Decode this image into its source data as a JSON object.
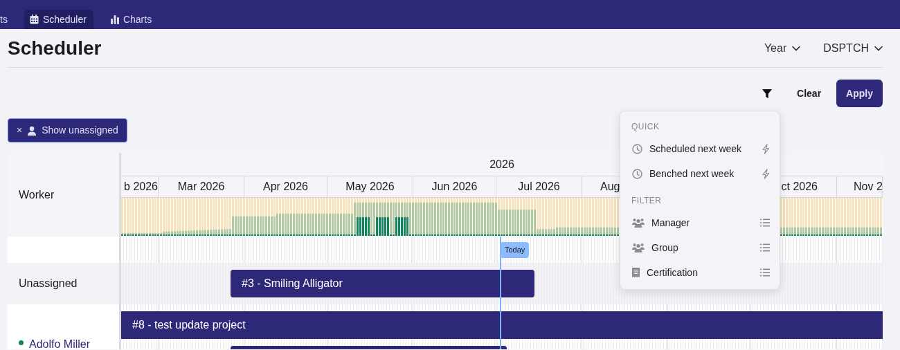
{
  "nav": {
    "tabs": [
      {
        "label": "ts",
        "selected": false
      },
      {
        "label": "Scheduler",
        "selected": true
      },
      {
        "label": "Charts",
        "selected": false
      }
    ]
  },
  "page": {
    "title": "Scheduler",
    "selectors": [
      {
        "label": "Year"
      },
      {
        "label": "DSPTCH"
      }
    ]
  },
  "filter_bar": {
    "clear": "Clear",
    "apply": "Apply"
  },
  "chips": [
    {
      "remove": "×",
      "label": "Show unassigned"
    }
  ],
  "filter_menu": {
    "sections": [
      {
        "heading": "QUICK",
        "items": [
          {
            "label": "Scheduled next week",
            "kind": "quick"
          },
          {
            "label": "Benched next week",
            "kind": "quick"
          }
        ]
      },
      {
        "heading": "FILTER",
        "items": [
          {
            "label": "Manager",
            "kind": "filter"
          },
          {
            "label": "Group",
            "kind": "filter"
          },
          {
            "label": "Certification",
            "kind": "filter"
          }
        ]
      }
    ]
  },
  "gantt": {
    "column_header": "Worker",
    "year": "2026",
    "months": [
      "b 2026",
      "Mar 2026",
      "Apr 2026",
      "May 2026",
      "Jun 2026",
      "Jul 2026",
      "Aug",
      "ct 2026",
      "Nov 2"
    ],
    "today_label": "Today",
    "rows": [
      {
        "kind": "spacer"
      },
      {
        "kind": "group",
        "label": "Unassigned",
        "bars": [
          {
            "kind": "task",
            "label": "#3 - Smiling Alligator"
          }
        ]
      },
      {
        "kind": "worker",
        "label": "Adolfo Miller",
        "color": "#12855d",
        "bars": [
          {
            "kind": "task",
            "label": "#8 - test update project"
          },
          {
            "kind": "task"
          }
        ]
      }
    ]
  }
}
